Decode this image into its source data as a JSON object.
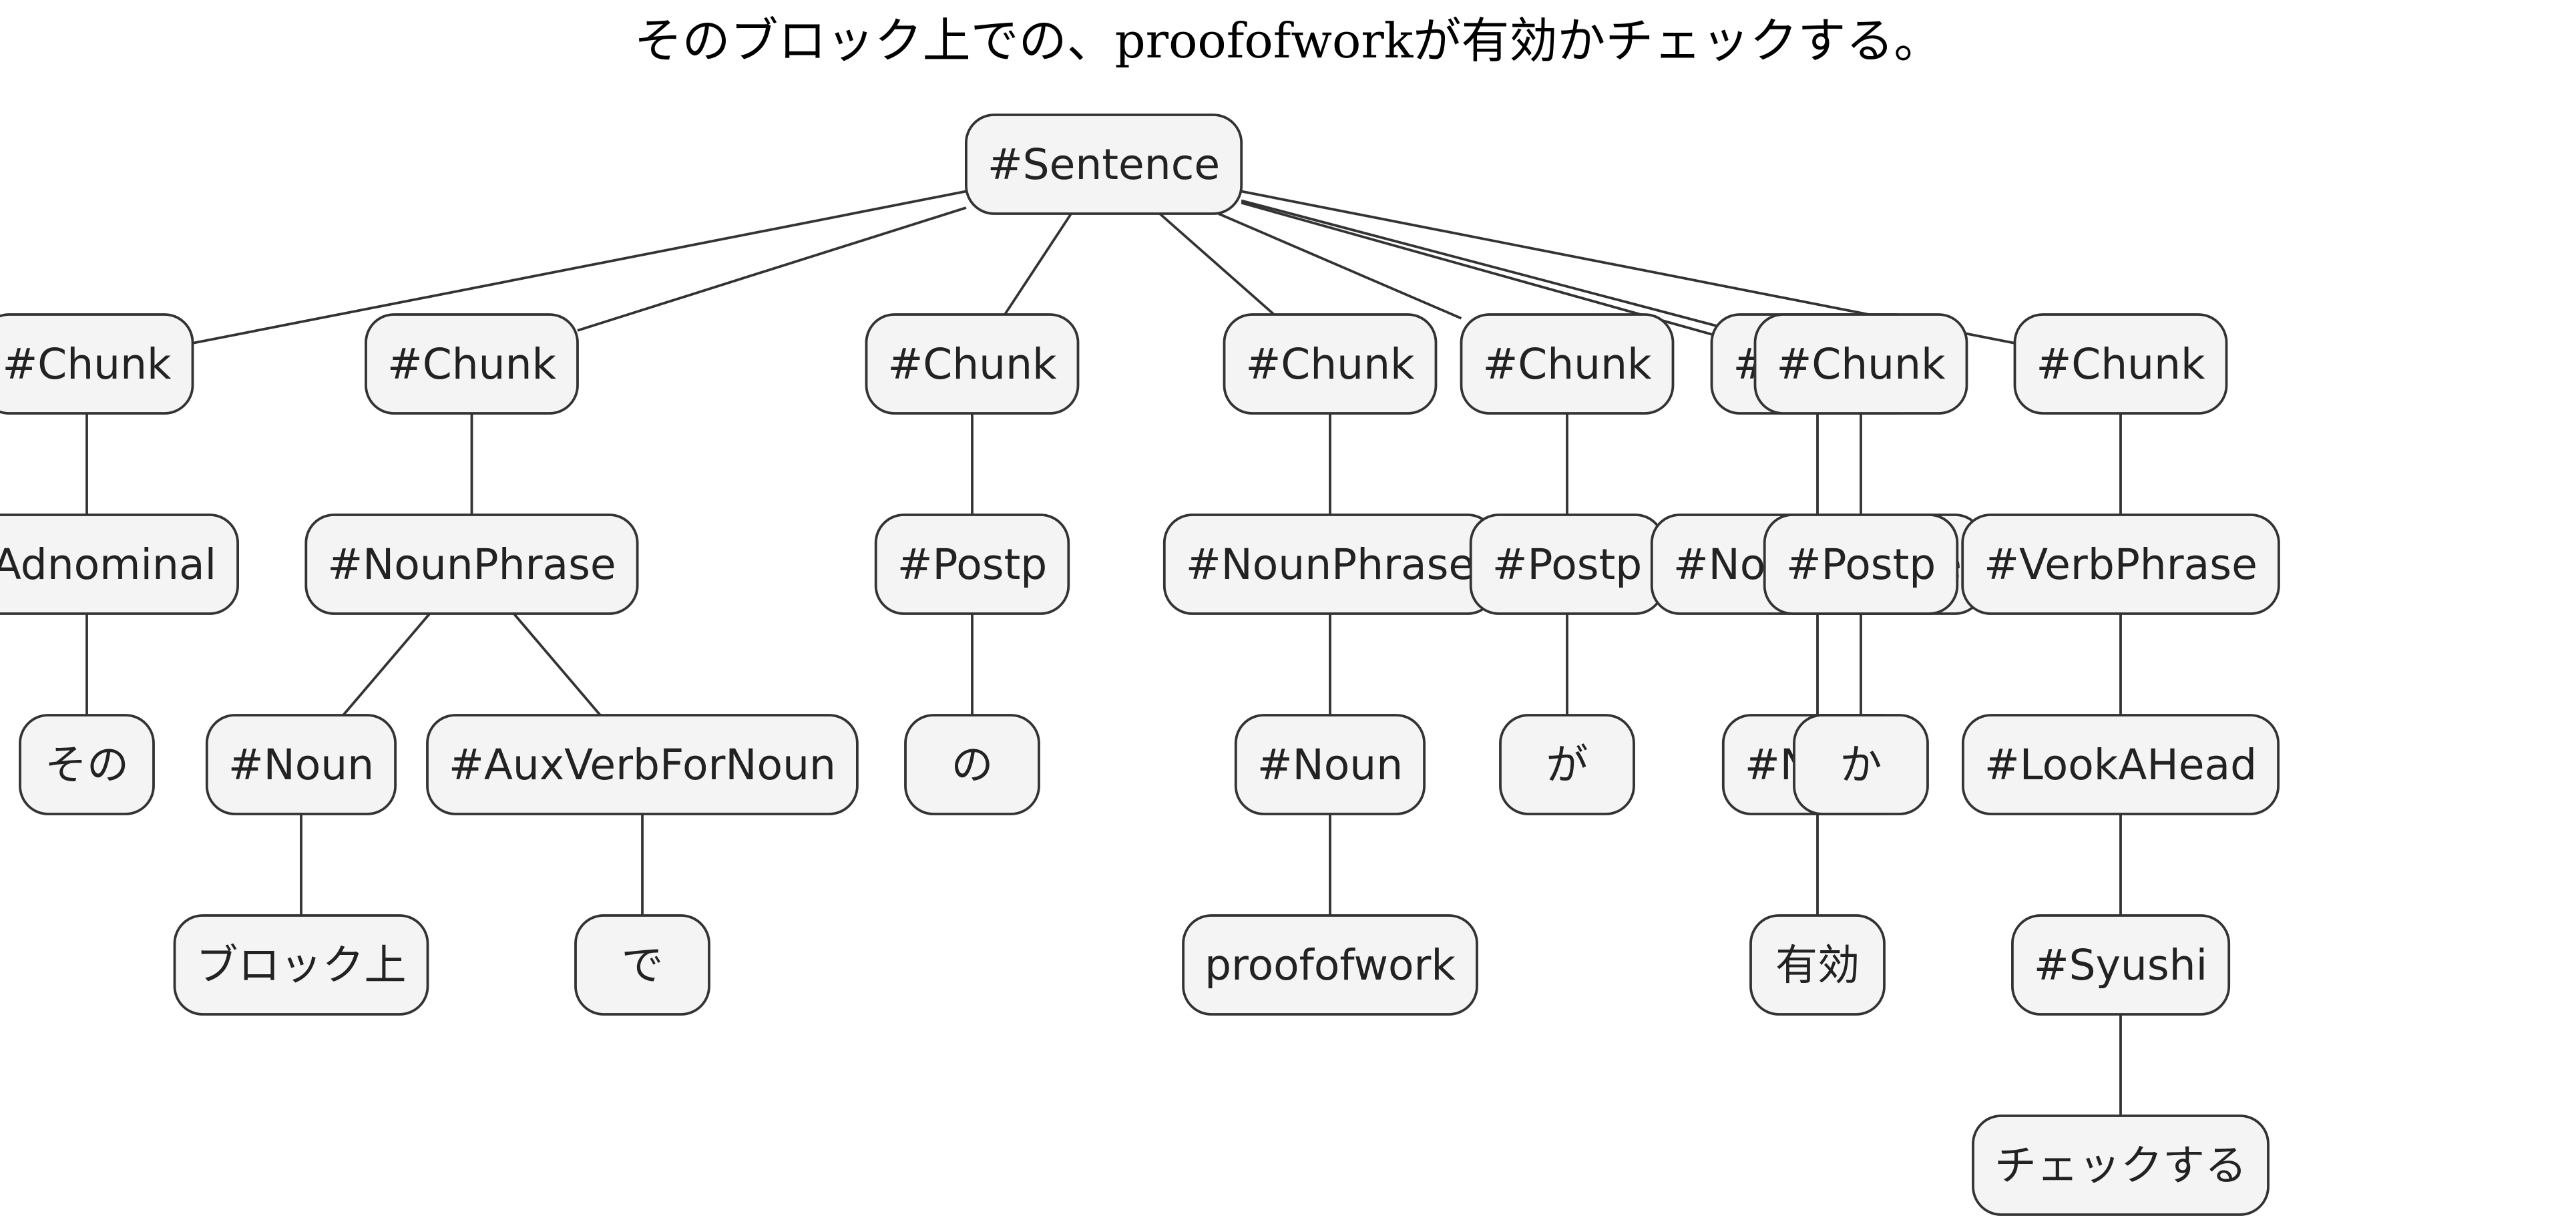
{
  "title": "そのブロック上での、proofofworkが有効かチェックする。",
  "tree": {
    "label": "#Sentence",
    "children": [
      {
        "label": "#Chunk",
        "children": [
          {
            "label": "#Adnominal",
            "children": [
              {
                "label": "その"
              }
            ]
          }
        ]
      },
      {
        "label": "#Chunk",
        "children": [
          {
            "label": "#NounPhrase",
            "children": [
              {
                "label": "#Noun",
                "children": [
                  {
                    "label": "ブロック上"
                  }
                ]
              },
              {
                "label": "#AuxVerbForNoun",
                "children": [
                  {
                    "label": "で"
                  }
                ]
              }
            ]
          }
        ]
      },
      {
        "label": "#Chunk",
        "children": [
          {
            "label": "#Postp",
            "children": [
              {
                "label": "の"
              }
            ]
          }
        ]
      },
      {
        "label": "#Chunk",
        "children": [
          {
            "label": "#NounPhrase",
            "children": [
              {
                "label": "#Noun",
                "children": [
                  {
                    "label": "proofofwork"
                  }
                ]
              }
            ]
          }
        ]
      },
      {
        "label": "#Chunk",
        "children": [
          {
            "label": "#Postp",
            "children": [
              {
                "label": "が"
              }
            ]
          }
        ]
      },
      {
        "label": "#Chunk",
        "children": [
          {
            "label": "#NounPhrase",
            "children": [
              {
                "label": "#Noun",
                "children": [
                  {
                    "label": "有効"
                  }
                ]
              }
            ]
          }
        ]
      },
      {
        "label": "#Chunk",
        "children": [
          {
            "label": "#Postp",
            "children": [
              {
                "label": "か"
              }
            ]
          }
        ]
      },
      {
        "label": "#Chunk",
        "children": [
          {
            "label": "#VerbPhrase",
            "children": [
              {
                "label": "#LookAHead",
                "children": [
                  {
                    "label": "#Syushi",
                    "children": [
                      {
                        "label": "チェックする"
                      }
                    ]
                  }
                ]
              }
            ]
          }
        ]
      }
    ]
  }
}
